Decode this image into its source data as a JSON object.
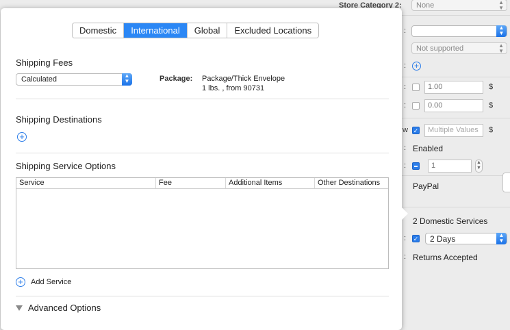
{
  "popover": {
    "tabs": [
      {
        "label": "Domestic",
        "active": false
      },
      {
        "label": "International",
        "active": true
      },
      {
        "label": "Global",
        "active": false
      },
      {
        "label": "Excluded Locations",
        "active": false
      }
    ],
    "shipping_fees": {
      "title": "Shipping Fees",
      "calc_value": "Calculated",
      "package_label": "Package:",
      "package_line1": "Package/Thick Envelope",
      "package_line2": "1 lbs. , from 90731"
    },
    "shipping_destinations": {
      "title": "Shipping Destinations"
    },
    "service_options": {
      "title": "Shipping Service Options",
      "columns": [
        "Service",
        "Fee",
        "Additional Items",
        "Other Destinations"
      ],
      "rows": [],
      "add_label": "Add Service"
    },
    "advanced": {
      "label": "Advanced Options"
    }
  },
  "background_panel": {
    "store_category_label": "Store Category 2:",
    "store_category_value": "None",
    "select_not_supported": "Not supported",
    "price_1": "1.00",
    "price_2": "0.00",
    "multiple_values_placeholder": "Multiple Values",
    "dollar": "$",
    "enabled_text": "Enabled",
    "quantity_value": "1",
    "payment_text": "PayPal",
    "domestic_services_text": "2 Domestic Services",
    "handling_time": "2 Days",
    "returns_text": "Returns Accepted",
    "colon": ":",
    "w_suffix": "w",
    "colors": {
      "accent": "#2b87f5",
      "background": "#ececec"
    }
  }
}
